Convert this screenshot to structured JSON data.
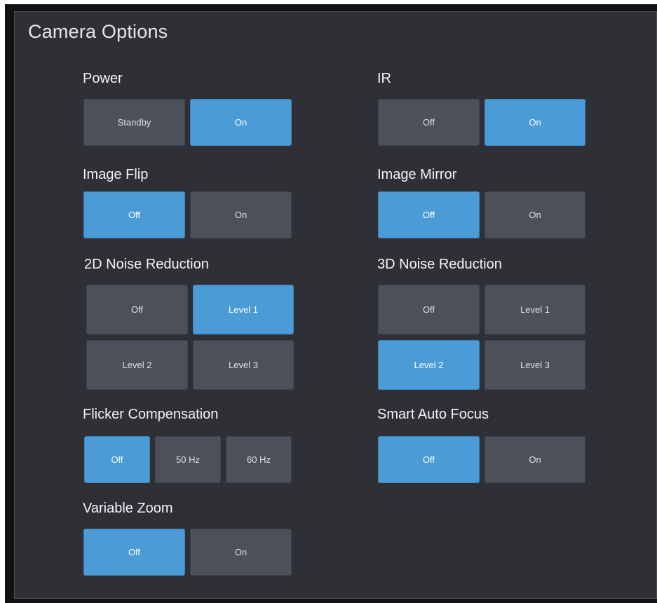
{
  "colors": {
    "panel_bg": "#2e3035",
    "button_bg": "#4b505a",
    "button_active": "#4a9bd6",
    "text": "#f3f4f6"
  },
  "panel": {
    "title": "Camera Options"
  },
  "groups": {
    "power": {
      "label": "Power",
      "options": [
        "Standby",
        "On"
      ],
      "selected": "On"
    },
    "ir": {
      "label": "IR",
      "options": [
        "Off",
        "On"
      ],
      "selected": "On"
    },
    "image_flip": {
      "label": "Image Flip",
      "options": [
        "Off",
        "On"
      ],
      "selected": "Off"
    },
    "image_mirror": {
      "label": "Image Mirror",
      "options": [
        "Off",
        "On"
      ],
      "selected": "Off"
    },
    "noise_2d": {
      "label": "2D Noise Reduction",
      "options": [
        "Off",
        "Level 1",
        "Level 2",
        "Level 3"
      ],
      "selected": "Level 1"
    },
    "noise_3d": {
      "label": "3D Noise Reduction",
      "options": [
        "Off",
        "Level 1",
        "Level 2",
        "Level 3"
      ],
      "selected": "Level 2"
    },
    "flicker": {
      "label": "Flicker Compensation",
      "options": [
        "Off",
        "50 Hz",
        "60 Hz"
      ],
      "selected": "Off"
    },
    "smart_af": {
      "label": "Smart Auto Focus",
      "options": [
        "Off",
        "On"
      ],
      "selected": "Off"
    },
    "variable_zoom": {
      "label": "Variable Zoom",
      "options": [
        "Off",
        "On"
      ],
      "selected": "Off"
    }
  }
}
